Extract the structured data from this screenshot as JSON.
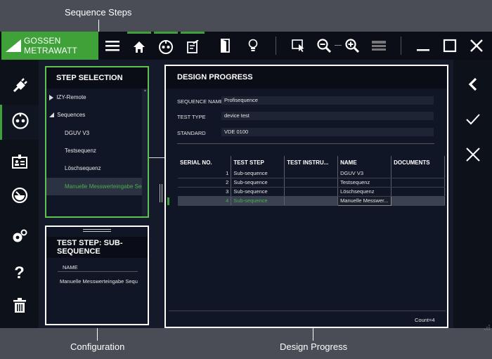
{
  "callouts": {
    "sequence_steps": "Sequence Steps",
    "configuration": "Configuration",
    "design_progress": "Design Progress"
  },
  "brand": {
    "name": "GOSSEN METRAWATT",
    "color": "#3ea238"
  },
  "colors": {
    "accent": "#3ea238",
    "panel_border": "#ffffff",
    "selected_text": "#4caf50"
  },
  "toolbar": {
    "icons": [
      "menu-icon",
      "home-icon",
      "socket-icon",
      "checklist-icon",
      "door-icon",
      "bulb-icon",
      "pointer-select-icon",
      "zoom-out-icon",
      "zoom-in-icon",
      "panel-icon",
      "minimize-icon",
      "maximize-icon",
      "close-icon"
    ]
  },
  "leftnav": {
    "icons": [
      "plug-icon",
      "socket-icon",
      "badge-icon",
      "gauge-icon",
      "settings-icon",
      "help-icon",
      "trash-icon"
    ]
  },
  "rightnav": {
    "icons": [
      "chevron-left-icon",
      "check-icon",
      "close-icon"
    ]
  },
  "step_selection": {
    "title": "STEP SELECTION",
    "items": [
      "IZY-Remote",
      "Sequences",
      "DGUV V3",
      "Testsequenz",
      "Löschsequenz",
      "Manuelle Messwerteingabe Seq"
    ]
  },
  "config": {
    "title": "TEST STEP: SUB-SEQUENCE",
    "name_label": "NAME",
    "name_value": "Manuelle Messwerteingabe Sequ"
  },
  "design": {
    "title": "DESIGN PROGRESS",
    "fields": [
      {
        "label": "SEQUENCE NAME",
        "value": "Profisequence"
      },
      {
        "label": "TEST TYPE",
        "value": "device test"
      },
      {
        "label": "STANDARD",
        "value": "VDE 0100"
      }
    ],
    "columns": [
      "SERIAL NO.",
      "TEST STEP",
      "TEST INSTRU...",
      "NAME",
      "DOCUMENTS"
    ],
    "rows": [
      {
        "serial": "1",
        "step": "Sub-sequence",
        "instr": "",
        "name": "DGUV V3",
        "docs": ""
      },
      {
        "serial": "2",
        "step": "Sub-sequence",
        "instr": "",
        "name": "Testsequenz",
        "docs": ""
      },
      {
        "serial": "3",
        "step": "Sub-sequence",
        "instr": "",
        "name": "Löschsequenz",
        "docs": ""
      },
      {
        "serial": "4",
        "step": "Sub-sequence",
        "instr": "",
        "name": "Manuelle Messwer...",
        "docs": ""
      }
    ],
    "count": "Count=4"
  }
}
